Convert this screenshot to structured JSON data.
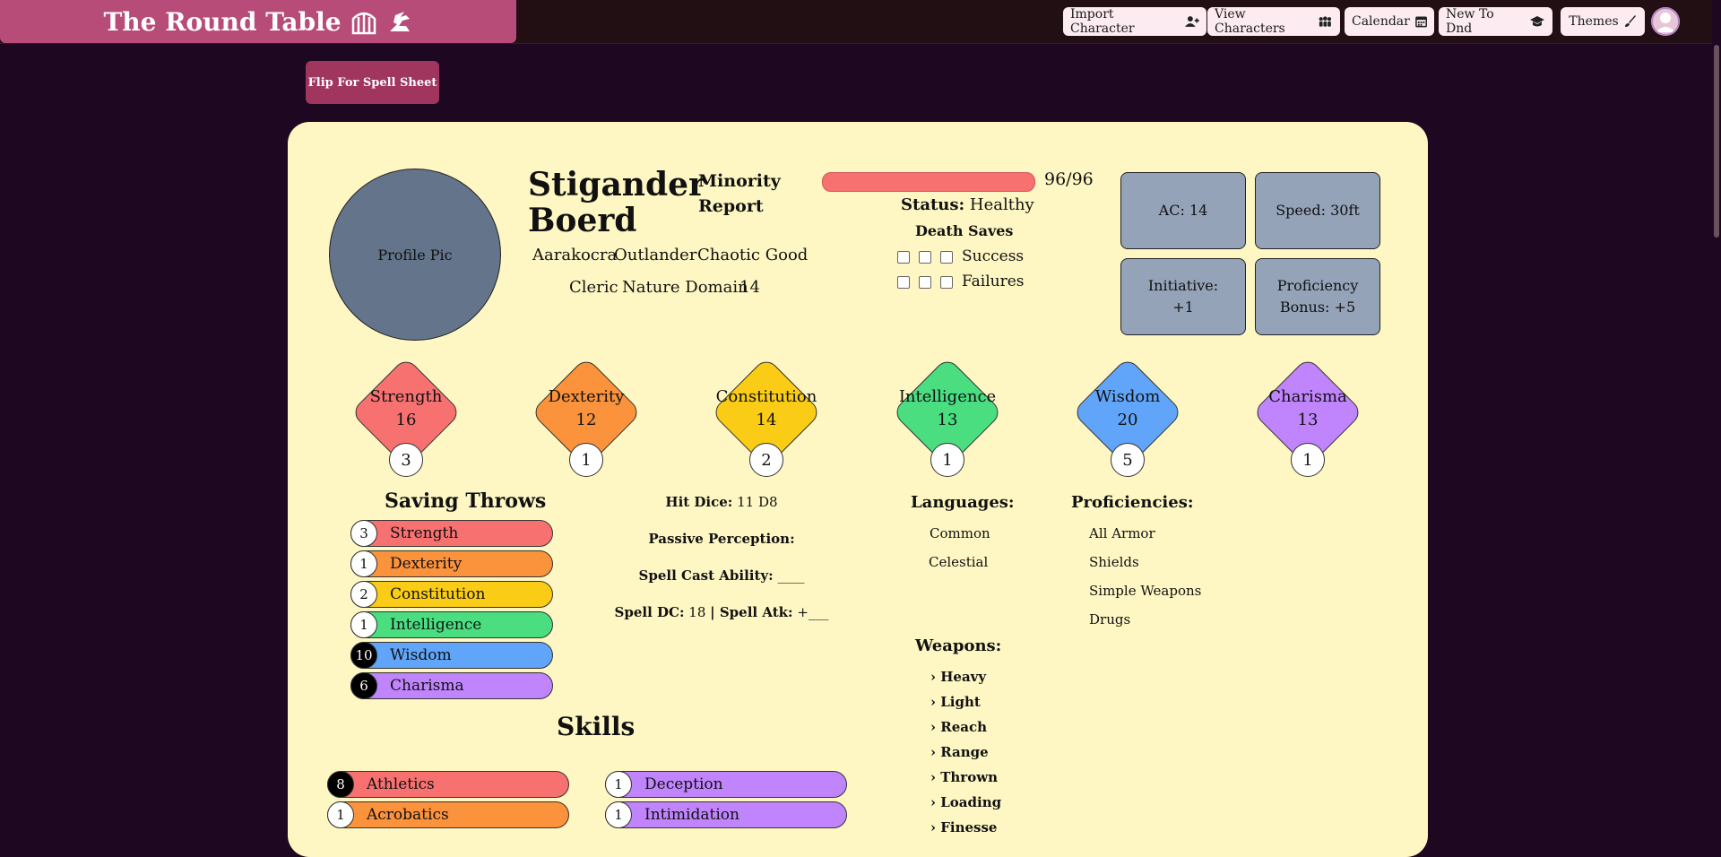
{
  "nav": {
    "brand": "The Round Table",
    "buttons": [
      {
        "label": "Import Character",
        "icon": "user-plus-icon"
      },
      {
        "label": "View Characters",
        "icon": "users-icon"
      },
      {
        "label": "Calendar",
        "icon": "calendar-icon"
      },
      {
        "label": "New To Dnd",
        "icon": "graduation-cap-icon"
      },
      {
        "label": "Themes",
        "icon": "paintbrush-icon"
      }
    ]
  },
  "flip_button": "Flip For Spell Sheet",
  "character": {
    "profile_pic": "Profile Pic",
    "name": "Stigander Boerd",
    "subtitle": "Minority Report",
    "race": "Aarakocra",
    "background": "Outlander",
    "alignment": "Chaotic Good",
    "class": "Cleric",
    "subclass": "Nature Domain",
    "level": "14"
  },
  "health": {
    "hp_text": "96/96",
    "hp_fraction": 1.0,
    "status_label": "Status:",
    "status_value": "Healthy",
    "death_saves_title": "Death Saves",
    "success_label": "Success",
    "failures_label": "Failures"
  },
  "stats": {
    "ac": "AC: 14",
    "speed": "Speed: 30ft",
    "initiative_line1": "Initiative:",
    "initiative_line2": "+1",
    "prof_line1": "Proficiency",
    "prof_line2": "Bonus: +5"
  },
  "abilities": [
    {
      "name": "Strength",
      "score": "16",
      "mod": "3",
      "color": "#f87171"
    },
    {
      "name": "Dexterity",
      "score": "12",
      "mod": "1",
      "color": "#fb923c"
    },
    {
      "name": "Constitution",
      "score": "14",
      "mod": "2",
      "color": "#facc15"
    },
    {
      "name": "Intelligence",
      "score": "13",
      "mod": "1",
      "color": "#4ade80"
    },
    {
      "name": "Wisdom",
      "score": "20",
      "mod": "5",
      "color": "#60a5fa"
    },
    {
      "name": "Charisma",
      "score": "13",
      "mod": "1",
      "color": "#c084fc"
    }
  ],
  "saving_throws": {
    "title": "Saving Throws",
    "items": [
      {
        "name": "Strength",
        "value": "3",
        "proficient": false,
        "color": "#f87171"
      },
      {
        "name": "Dexterity",
        "value": "1",
        "proficient": false,
        "color": "#fb923c"
      },
      {
        "name": "Constitution",
        "value": "2",
        "proficient": false,
        "color": "#facc15"
      },
      {
        "name": "Intelligence",
        "value": "1",
        "proficient": false,
        "color": "#4ade80"
      },
      {
        "name": "Wisdom",
        "value": "10",
        "proficient": true,
        "color": "#60a5fa"
      },
      {
        "name": "Charisma",
        "value": "6",
        "proficient": true,
        "color": "#c084fc"
      }
    ]
  },
  "middle": {
    "hit_dice_label": "Hit Dice:",
    "hit_dice_value": "11 D8",
    "passive_label": "Passive Perception:",
    "spell_cast_label": "Spell Cast Ability:",
    "spell_cast_value": "____",
    "spell_dc_label": "Spell DC:",
    "spell_dc_value": "18",
    "spell_atk_label": "| Spell Atk:",
    "spell_atk_value": "+___"
  },
  "languages": {
    "title": "Languages:",
    "items": [
      "Common",
      "Celestial"
    ]
  },
  "proficiencies": {
    "title": "Proficiencies:",
    "items": [
      "All Armor",
      "Shields",
      "Simple Weapons",
      "Drugs"
    ]
  },
  "weapons": {
    "title": "Weapons:",
    "items": [
      "Heavy",
      "Light",
      "Reach",
      "Range",
      "Thrown",
      "Loading",
      "Finesse"
    ]
  },
  "skills": {
    "title": "Skills",
    "left": [
      {
        "name": "Athletics",
        "value": "8",
        "proficient": true,
        "color": "#f87171"
      },
      {
        "name": "Acrobatics",
        "value": "1",
        "proficient": false,
        "color": "#fb923c"
      }
    ],
    "right": [
      {
        "name": "Deception",
        "value": "1",
        "proficient": false,
        "color": "#c084fc"
      },
      {
        "name": "Intimidation",
        "value": "1",
        "proficient": false,
        "color": "#c084fc"
      }
    ]
  }
}
